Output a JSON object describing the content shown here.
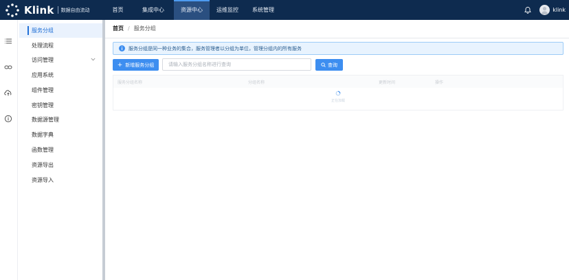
{
  "app": {
    "logo_text": "Klink",
    "logo_subtitle": "数据自由流动"
  },
  "nav": {
    "items": [
      {
        "label": "首页"
      },
      {
        "label": "集成中心"
      },
      {
        "label": "资源中心"
      },
      {
        "label": "运维监控"
      },
      {
        "label": "系统管理"
      }
    ],
    "active": "资源中心"
  },
  "user": {
    "name": "klink"
  },
  "sidebar": {
    "items": [
      {
        "label": "服务分组"
      },
      {
        "label": "处理流程"
      },
      {
        "label": "访问管理"
      },
      {
        "label": "应用系统"
      },
      {
        "label": "组件管理"
      },
      {
        "label": "密钥管理"
      },
      {
        "label": "数据源管理"
      },
      {
        "label": "数据字典"
      },
      {
        "label": "函数管理"
      },
      {
        "label": "资源导出"
      },
      {
        "label": "资源导入"
      }
    ],
    "active": "服务分组"
  },
  "breadcrumb": {
    "home": "首页",
    "separator": "/",
    "current": "服务分组"
  },
  "notice": {
    "text": "服务分组是同一种业务的集合，服务管理者以分组为单位，管理分组内的所有服务"
  },
  "toolbar": {
    "add_label": "新增服务分组",
    "search_placeholder": "请输入服务分组名称进行查询",
    "search_value": "",
    "query_label": "查询"
  },
  "table": {
    "columns": [
      {
        "label": "服务分组名称"
      },
      {
        "label": "分组名称"
      },
      {
        "label": "更新时间"
      },
      {
        "label": "操作"
      }
    ],
    "loading_text": "正在加载"
  },
  "colors": {
    "topbar": "#0e2b4f",
    "accent": "#3d8ef0",
    "active_nav": "#2a4f80"
  }
}
